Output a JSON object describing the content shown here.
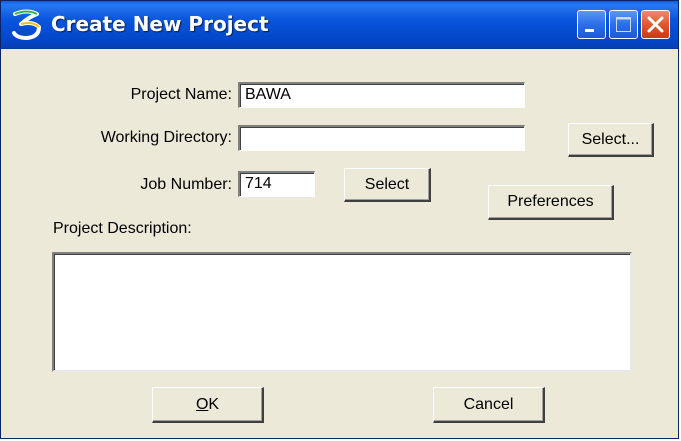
{
  "window": {
    "title": "Create New Project",
    "icon": "microstation-s-icon"
  },
  "titlebar_buttons": {
    "minimize": "minimize-icon",
    "maximize": "maximize-icon",
    "close": "close-icon"
  },
  "form": {
    "project_name_label": "Project Name:",
    "project_name_value": "BAWA",
    "working_directory_label": "Working Directory:",
    "working_directory_value": "",
    "job_number_label": "Job Number:",
    "job_number_value": "714",
    "project_description_label": "Project Description:",
    "project_description_value": ""
  },
  "buttons": {
    "select_directory": "Select...",
    "select_job": "Select",
    "preferences": "Preferences",
    "ok_mnemonic": "O",
    "ok_rest": "K",
    "cancel": "Cancel"
  },
  "colors": {
    "titlebar": "#0855dd",
    "dialog_bg": "#ece9d8",
    "close_button": "#e0572e"
  }
}
